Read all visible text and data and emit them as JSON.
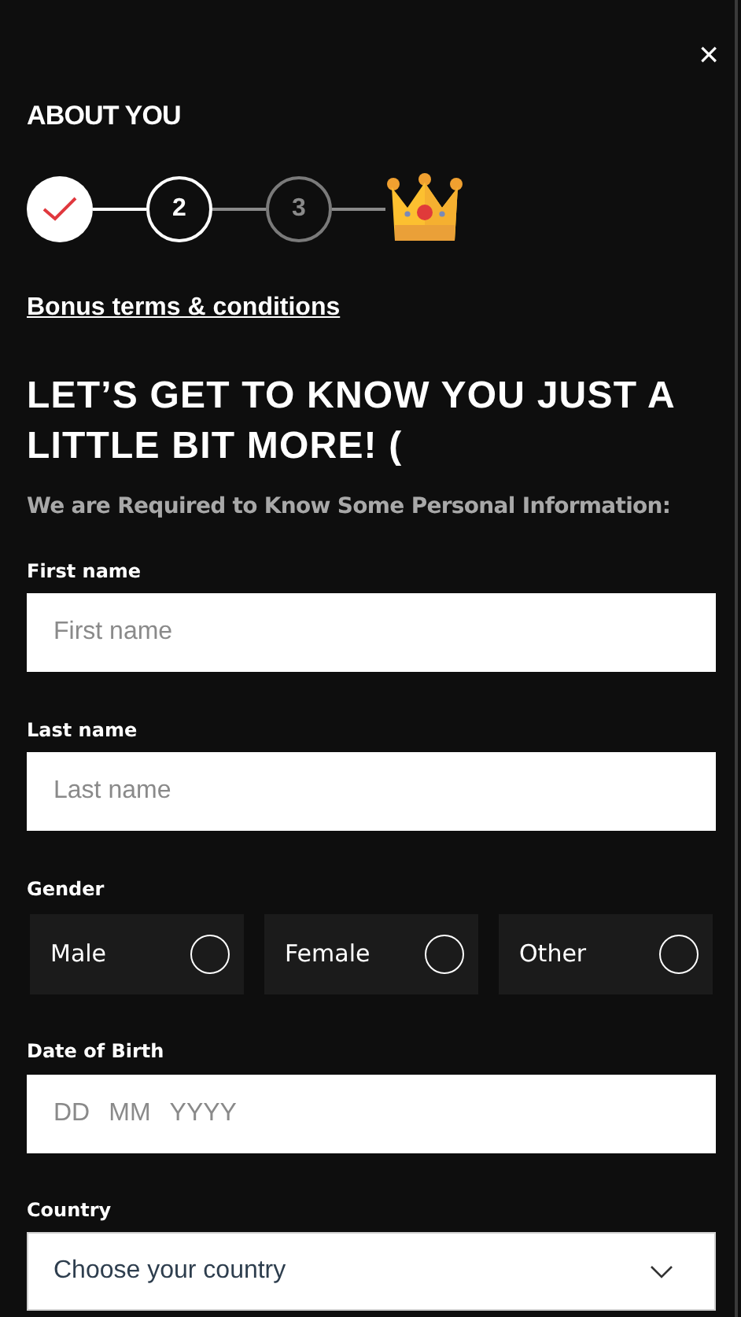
{
  "close": "×",
  "title": "ABOUT YOU",
  "steps": [
    {
      "kind": "done"
    },
    {
      "label": "2",
      "kind": "current"
    },
    {
      "label": "3",
      "kind": "upcoming"
    }
  ],
  "bonus_link": "Bonus terms & conditions",
  "heading": "LET’S GET TO KNOW YOU JUST A LITTLE BIT MORE! (",
  "subtitle": "We are Required to Know Some Personal Information:",
  "first_name": {
    "label": "First name",
    "placeholder": "First name"
  },
  "last_name": {
    "label": "Last name",
    "placeholder": "Last name"
  },
  "gender": {
    "label": "Gender",
    "options": [
      {
        "label": "Male",
        "selected": false
      },
      {
        "label": "Female",
        "selected": false
      },
      {
        "label": "Other",
        "selected": false
      }
    ]
  },
  "date_of_birth": {
    "label": "Date of Birth",
    "placeholders": [
      "DD",
      "MM",
      "YYYY"
    ]
  },
  "country": {
    "label": "Country",
    "value": "Choose your country"
  }
}
